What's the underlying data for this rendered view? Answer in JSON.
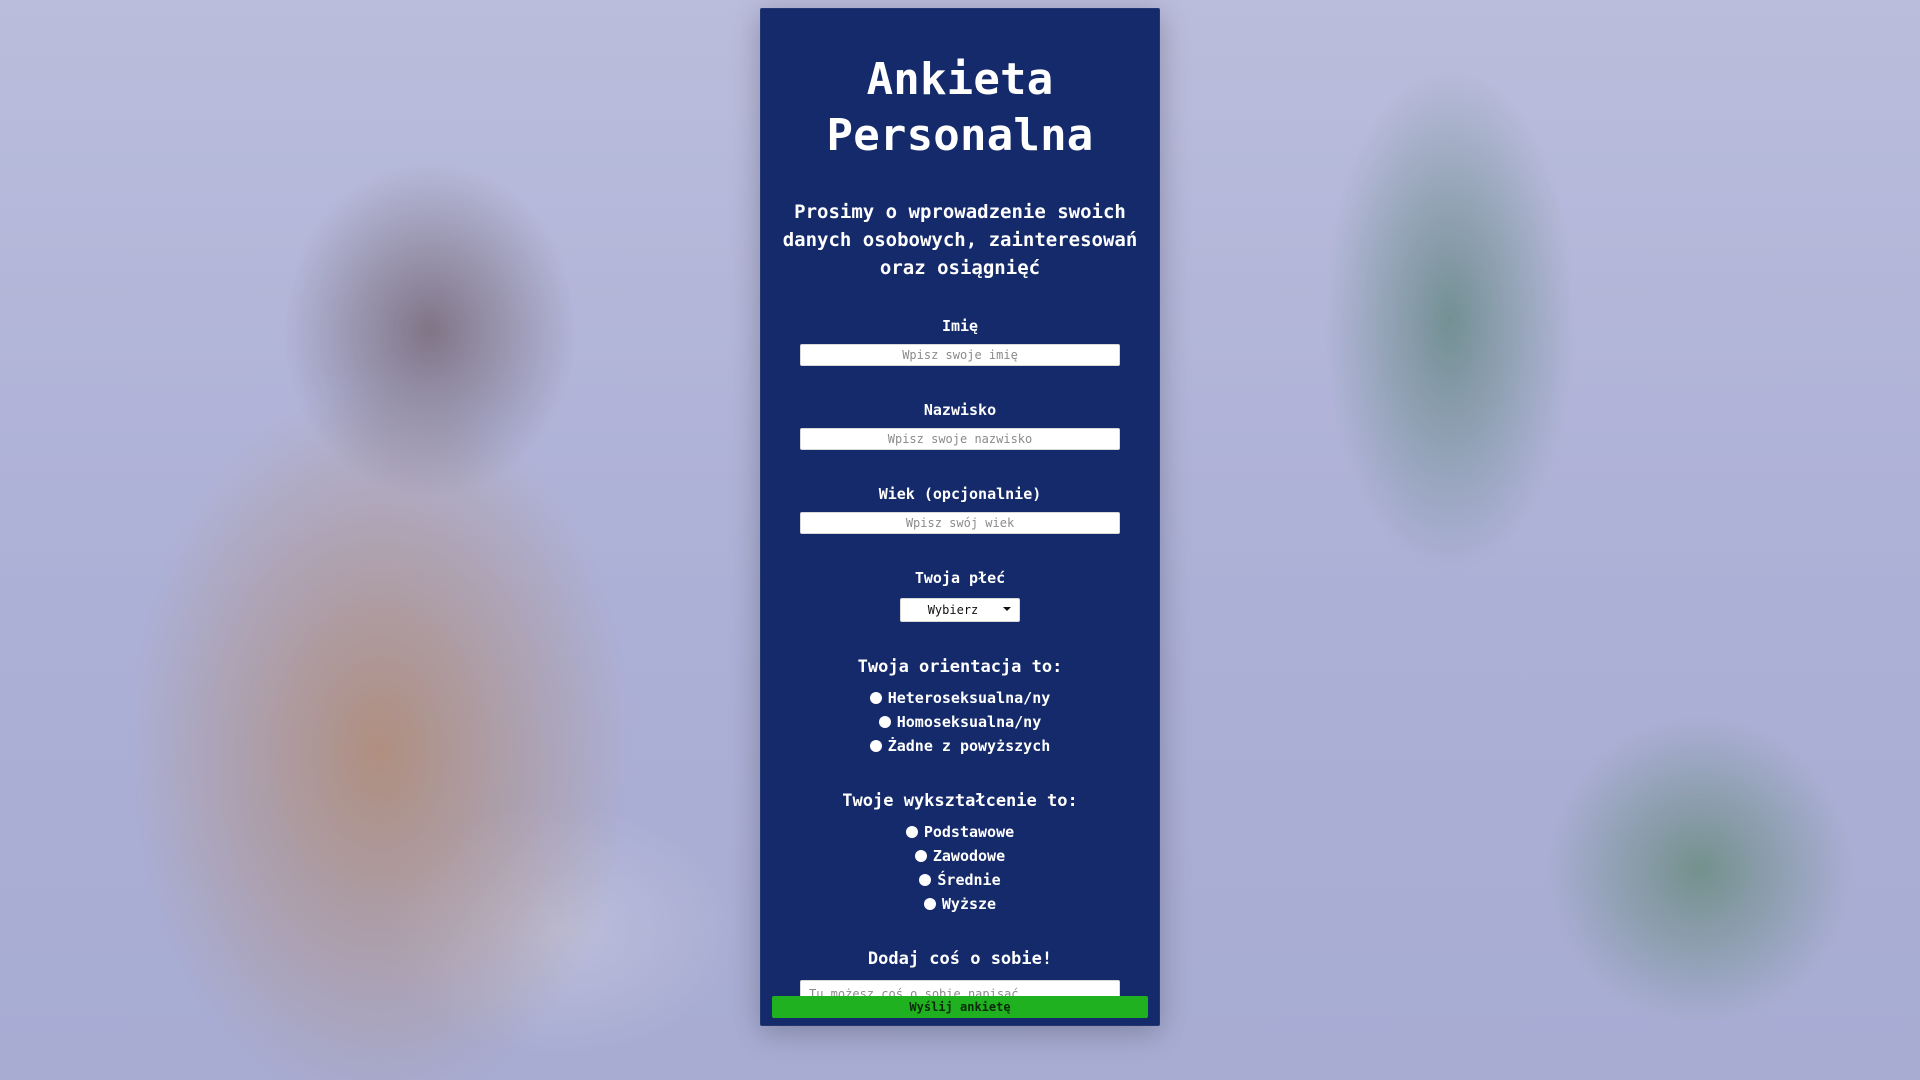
{
  "form": {
    "title_line1": "Ankieta",
    "title_line2": "Personalna",
    "subtitle": "Prosimy o wprowadzenie swoich danych osobowych, zainteresowań oraz osiągnięć",
    "fields": {
      "first_name": {
        "label": "Imię",
        "placeholder": "Wpisz swoje imię",
        "value": ""
      },
      "last_name": {
        "label": "Nazwisko",
        "placeholder": "Wpisz swoje nazwisko",
        "value": ""
      },
      "age": {
        "label": "Wiek (opcjonalnie)",
        "placeholder": "Wpisz swój wiek",
        "value": ""
      },
      "gender": {
        "label": "Twoja płeć",
        "selected": "Wybierz"
      },
      "orientation": {
        "label": "Twoja orientacja to:",
        "options": [
          "Heteroseksualna/ny",
          "Homoseksualna/ny",
          "Żadne z powyższych"
        ]
      },
      "education": {
        "label": "Twoje wykształcenie to:",
        "options": [
          "Podstawowe",
          "Zawodowe",
          "Średnie",
          "Wyższe"
        ]
      },
      "about": {
        "label": "Dodaj coś o sobie!",
        "placeholder": "Tu możesz coś o sobie napisać",
        "value": ""
      }
    },
    "submit_label": "Wyślij ankietę"
  },
  "colors": {
    "panel_bg": "#152a6a",
    "submit_bg": "#1fb11f"
  }
}
